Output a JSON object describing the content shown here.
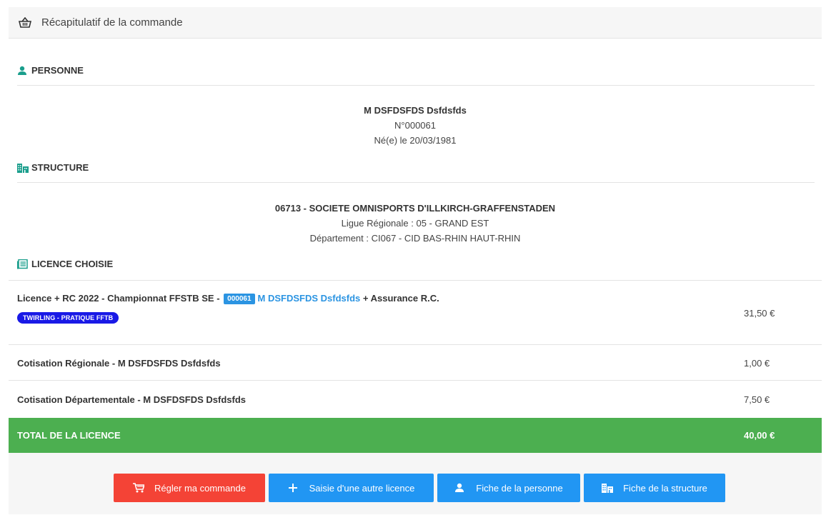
{
  "header": {
    "title": "Récapitulatif de la commande",
    "icon": "basket-icon"
  },
  "person": {
    "section_title": "PERSONNE",
    "name": "M DSFDSFDS Dsfdsfds",
    "number": "N°000061",
    "birth": "Né(e) le 20/03/1981"
  },
  "structure": {
    "section_title": "STRUCTURE",
    "name": "06713 - SOCIETE OMNISPORTS D'ILLKIRCH-GRAFFENSTADEN",
    "ligue": "Ligue Régionale : 05 - GRAND EST",
    "departement": "Département : CI067 - CID BAS-RHIN HAUT-RHIN"
  },
  "licence": {
    "section_title": "LICENCE CHOISIE",
    "main_line": {
      "prefix": "Licence + RC 2022 - Championnat FFSTB SE - ",
      "badge": "000061",
      "person": "M DSFDSFDS Dsfdsfds",
      "suffix": " + Assurance R.C.",
      "tag": "TWIRLING - PRATIQUE FFTB",
      "amount": "31,50 €"
    },
    "lines": [
      {
        "label": "Cotisation Régionale - M DSFDSFDS Dsfdsfds",
        "amount": "1,00 €"
      },
      {
        "label": "Cotisation Départementale - M DSFDSFDS Dsfdsfds",
        "amount": "7,50 €"
      }
    ],
    "total": {
      "label": "TOTAL DE LA LICENCE",
      "amount": "40,00 €"
    }
  },
  "buttons": {
    "pay": "Régler ma commande",
    "new_licence": "Saisie d'une autre licence",
    "person_sheet": "Fiche de la personne",
    "structure_sheet": "Fiche de la structure"
  },
  "colors": {
    "accent": "#2196f3",
    "danger": "#f44336",
    "success": "#4caf50",
    "tag": "#1919e6",
    "section_icon": "#1a9e8c"
  }
}
